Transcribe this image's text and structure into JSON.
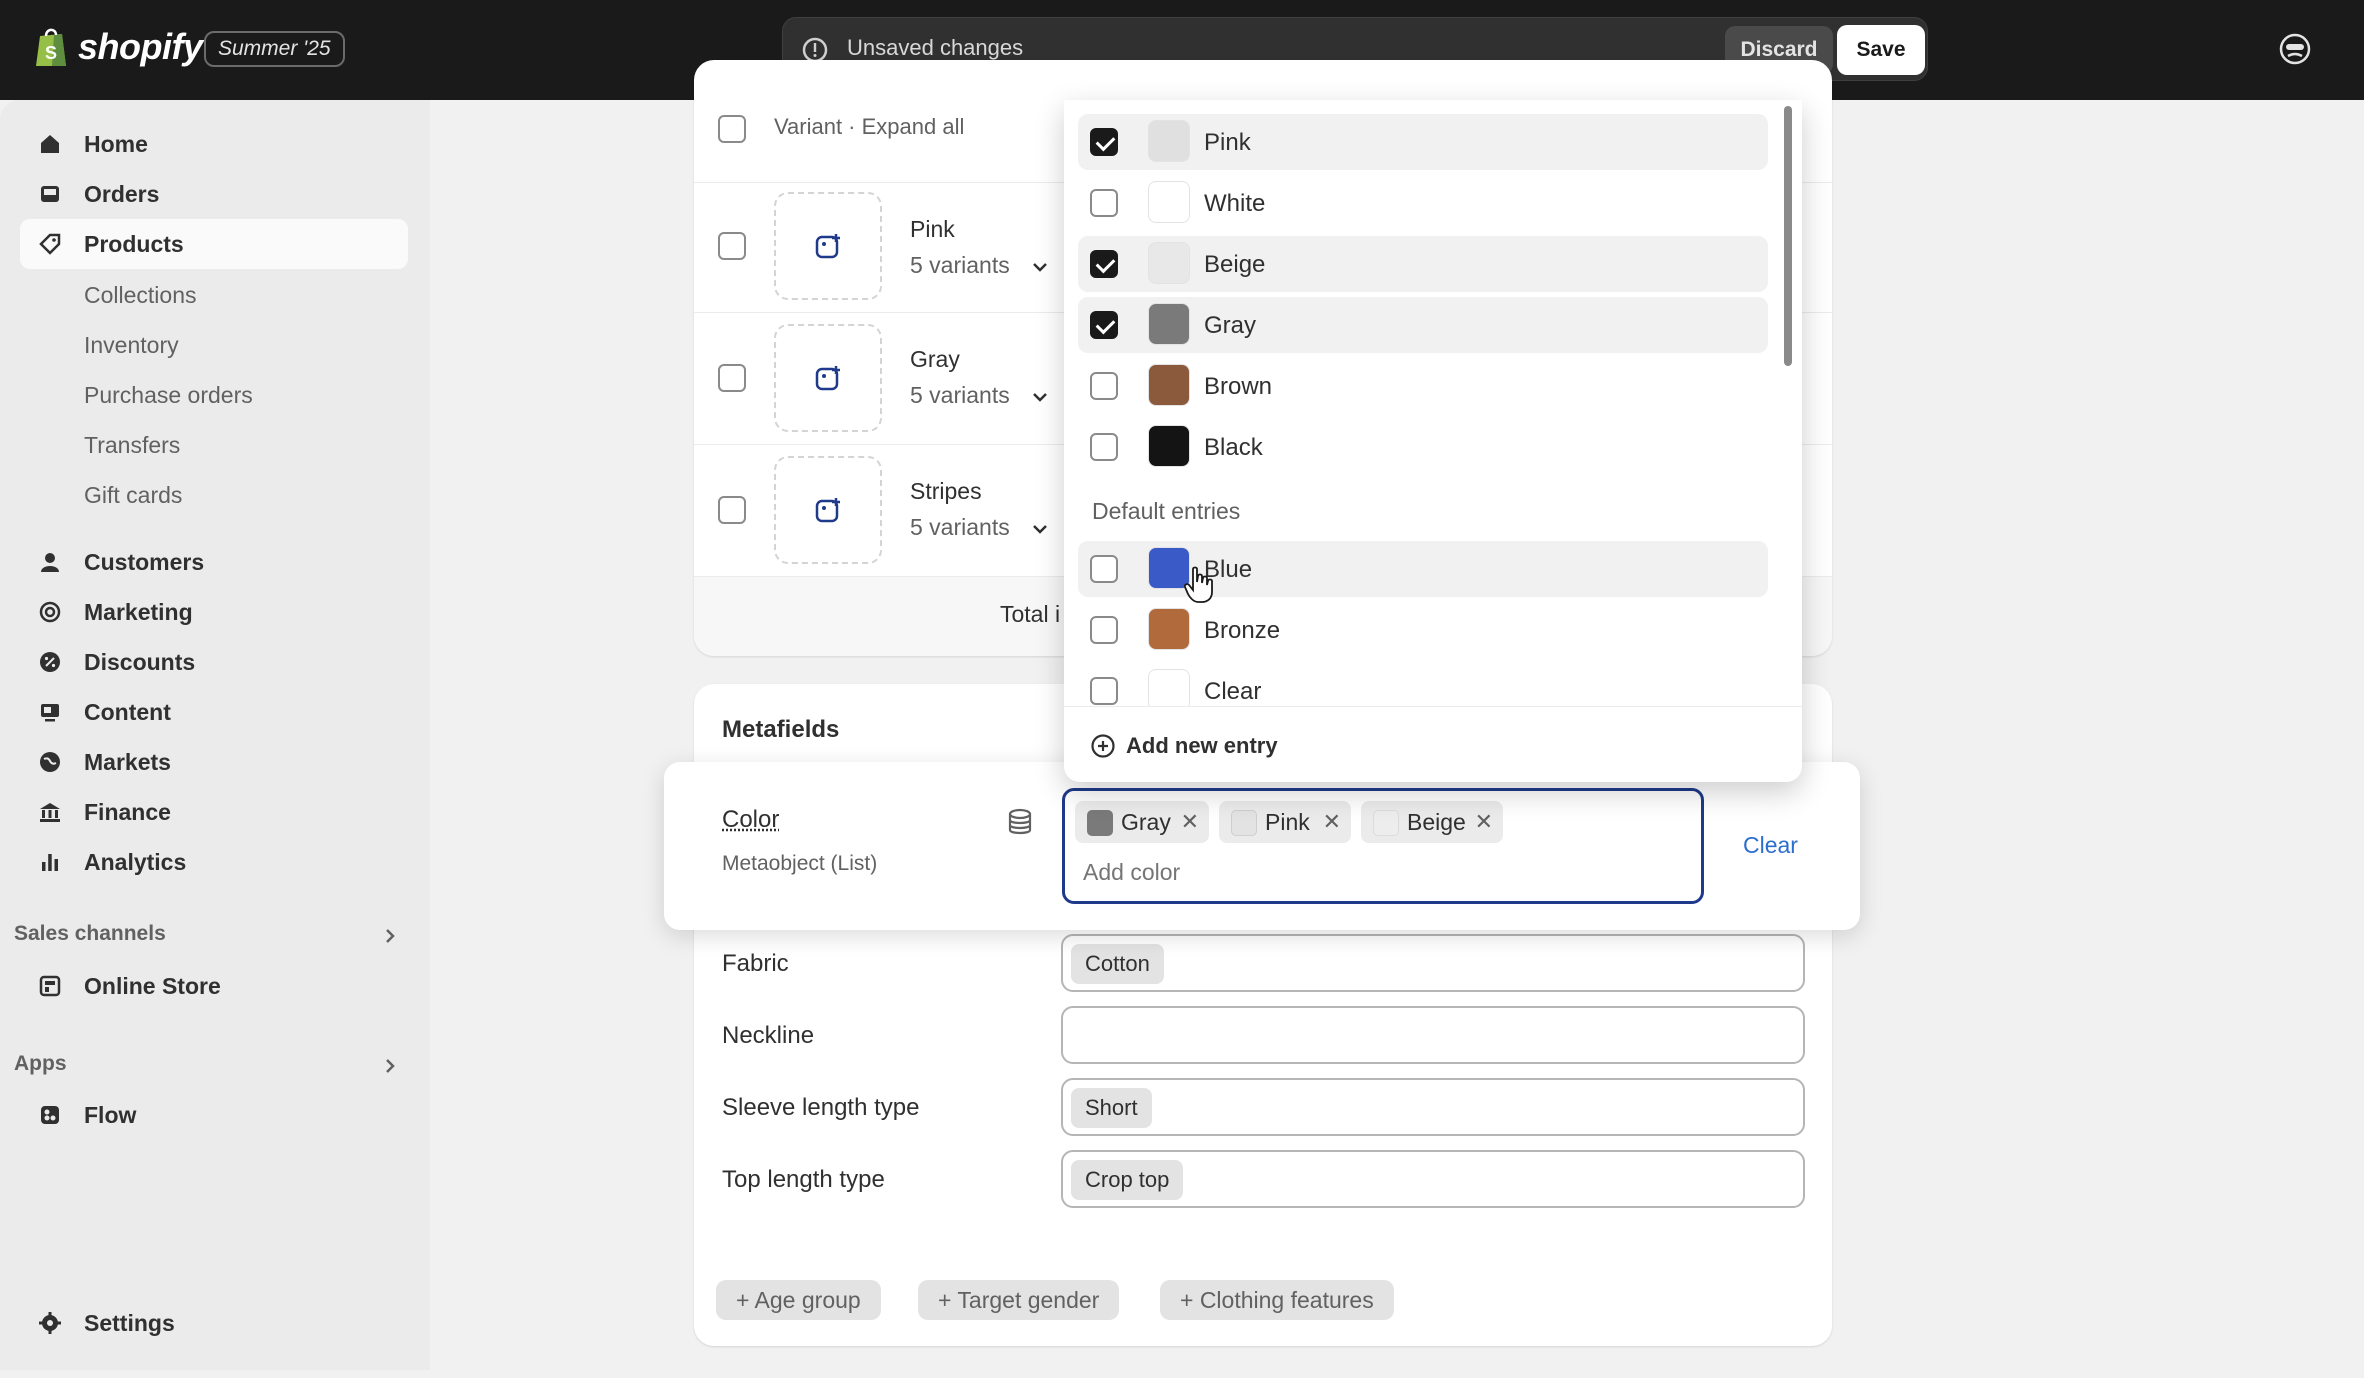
{
  "topbar": {
    "brand": "shopify",
    "edition": "Summer '25",
    "unsaved_text": "Unsaved changes",
    "discard_label": "Discard",
    "save_label": "Save"
  },
  "sidebar": {
    "main_items": [
      {
        "label": "Home",
        "icon": "home-icon"
      },
      {
        "label": "Orders",
        "icon": "inbox-icon"
      },
      {
        "label": "Products",
        "icon": "tag-icon",
        "active": true
      }
    ],
    "product_subitems": [
      "Collections",
      "Inventory",
      "Purchase orders",
      "Transfers",
      "Gift cards"
    ],
    "more_items": [
      {
        "label": "Customers",
        "icon": "person-icon"
      },
      {
        "label": "Marketing",
        "icon": "target-icon"
      },
      {
        "label": "Discounts",
        "icon": "discount-icon"
      },
      {
        "label": "Content",
        "icon": "content-icon"
      },
      {
        "label": "Markets",
        "icon": "globe-icon"
      },
      {
        "label": "Finance",
        "icon": "bank-icon"
      },
      {
        "label": "Analytics",
        "icon": "chart-icon"
      }
    ],
    "sales_channels_title": "Sales channels",
    "online_store": "Online Store",
    "apps_title": "Apps",
    "flow": "Flow",
    "settings": "Settings"
  },
  "variants": {
    "header": "Variant · Expand all",
    "rows": [
      {
        "name": "Pink",
        "count": "5 variants"
      },
      {
        "name": "Gray",
        "count": "5 variants"
      },
      {
        "name": "Stripes",
        "count": "5 variants"
      }
    ],
    "total_label": "Total i"
  },
  "metafields": {
    "title": "Metafields",
    "color": {
      "label": "Color",
      "type": "Metaobject (List)",
      "placeholder": "Add color",
      "clear_label": "Clear",
      "selected": [
        {
          "name": "Gray",
          "swatch": "#7a7a7a"
        },
        {
          "name": "Pink",
          "swatch": "#e3e3e3"
        },
        {
          "name": "Beige",
          "swatch": "#ebebeb"
        }
      ]
    },
    "fields": [
      {
        "label": "Fabric",
        "value": "Cotton"
      },
      {
        "label": "Neckline",
        "value": ""
      },
      {
        "label": "Sleeve length type",
        "value": "Short"
      },
      {
        "label": "Top length type",
        "value": "Crop top"
      }
    ],
    "add_pills": [
      "+ Age group",
      "+ Target gender",
      "+ Clothing features"
    ]
  },
  "dropdown": {
    "options": [
      {
        "name": "Pink",
        "swatch": "#e0e0e0",
        "checked": true
      },
      {
        "name": "White",
        "swatch": "#ffffff",
        "checked": false
      },
      {
        "name": "Beige",
        "swatch": "#e8e8e8",
        "checked": true
      },
      {
        "name": "Gray",
        "swatch": "#7a7a7a",
        "checked": true
      },
      {
        "name": "Brown",
        "swatch": "#8b5a3c",
        "checked": false
      },
      {
        "name": "Black",
        "swatch": "#141414",
        "checked": false
      }
    ],
    "default_section": "Default entries",
    "defaults": [
      {
        "name": "Blue",
        "swatch": "#3a5bc7",
        "checked": false
      },
      {
        "name": "Bronze",
        "swatch": "#b06a3b",
        "checked": false
      },
      {
        "name": "Clear",
        "swatch": "#ffffff",
        "checked": false
      }
    ],
    "add_entry": "Add new entry"
  },
  "colors": {
    "topbar": "#1a1a1a",
    "focus_border": "#1f3a8a",
    "link": "#2c6ecb"
  }
}
